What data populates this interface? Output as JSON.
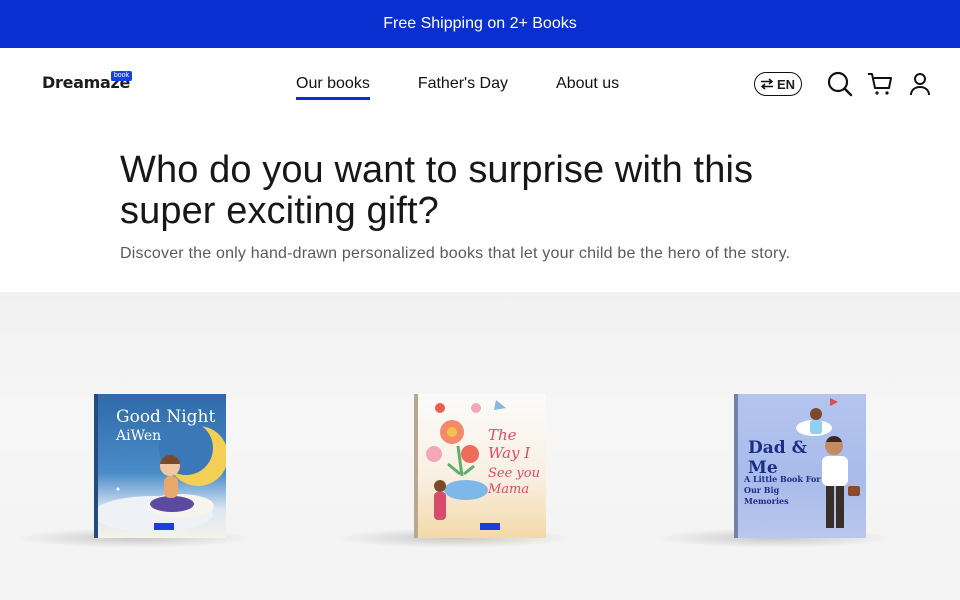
{
  "promo": {
    "text": "Free Shipping on 2+ Books"
  },
  "header": {
    "logo_text": "Dreamaze",
    "logo_tag": "book",
    "nav": [
      {
        "label": "Our books",
        "active": true
      },
      {
        "label": "Father's Day",
        "active": false
      },
      {
        "label": "About us",
        "active": false
      }
    ],
    "language": "EN",
    "icons": [
      "language-switch-icon",
      "search-icon",
      "cart-icon",
      "account-icon"
    ]
  },
  "hero": {
    "title": "Who do you want to surprise with this super exciting gift?",
    "subtitle": "Discover the only hand-drawn personalized books that let your child be the hero of the story."
  },
  "books": [
    {
      "title_line1": "Good Night",
      "title_line2": "AiWen",
      "cover_color": "#3a78b8"
    },
    {
      "title_line1": "The Way I",
      "title_line2": "See you Mama",
      "cover_color": "#f6e6cf"
    },
    {
      "title_line1": "Dad & Me",
      "title_line2": "A Little Book For Our Big Memories",
      "cover_color": "#9fb4ea"
    }
  ],
  "colors": {
    "brand": "#0a2fd0"
  }
}
